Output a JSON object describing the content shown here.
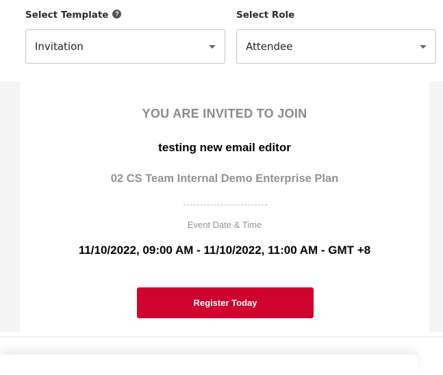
{
  "template_select": {
    "label": "Select Template",
    "value": "Invitation"
  },
  "role_select": {
    "label": "Select Role",
    "value": "Attendee"
  },
  "email_preview": {
    "heading": "YOU ARE INVITED TO JOIN",
    "event_title": "testing new email editor",
    "organization": "02 CS Team Internal Demo Enterprise Plan",
    "date_label": "Event Date & Time",
    "date_value": "11/10/2022, 09:00 AM - 11/10/2022, 11:00 AM - GMT +8",
    "register_button": "Register Today",
    "colors": {
      "button": "#d0022e",
      "muted_text": "#8d9398"
    }
  },
  "icons": {
    "help": "help-circle-icon",
    "dropdown": "caret-down-icon"
  }
}
